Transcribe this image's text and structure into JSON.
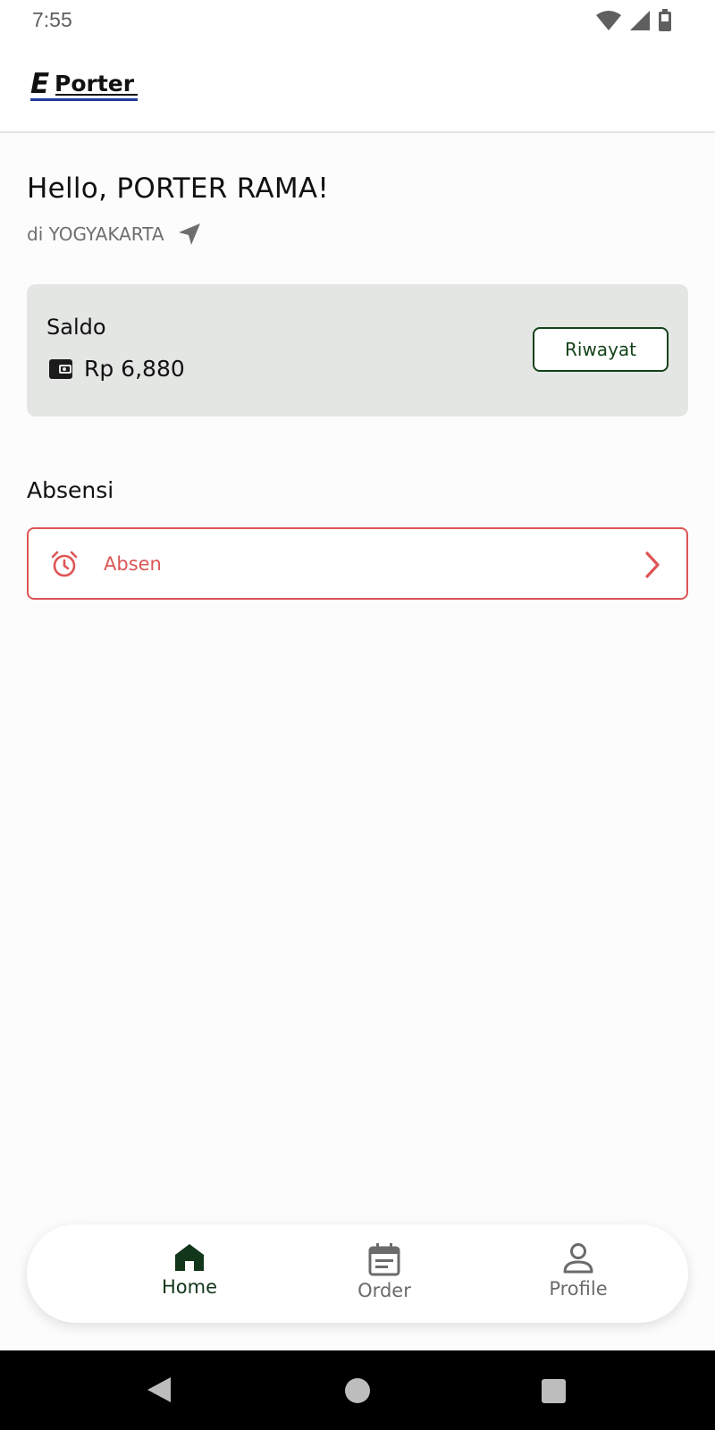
{
  "status_bar": {
    "time": "7:55",
    "icons": [
      "wifi-icon",
      "signal-icon",
      "battery-icon"
    ]
  },
  "app": {
    "logo_text_e": "E",
    "logo_text_rest": "Porter"
  },
  "greeting": {
    "text": "Hello, PORTER RAMA!",
    "location": "di YOGYAKARTA",
    "location_icon": "navigation-arrow-icon"
  },
  "saldo": {
    "label": "Saldo",
    "amount": "Rp 6,880",
    "wallet_icon": "wallet-icon",
    "history_button": "Riwayat"
  },
  "absensi": {
    "title": "Absensi",
    "item_label": "Absen",
    "item_icon": "alarm-clock-icon",
    "chevron_icon": "chevron-right-icon"
  },
  "bottom_nav": {
    "items": [
      {
        "label": "Home",
        "icon": "home-icon",
        "active": true
      },
      {
        "label": "Order",
        "icon": "calendar-icon",
        "active": false
      },
      {
        "label": "Profile",
        "icon": "person-icon",
        "active": false
      }
    ]
  },
  "colors": {
    "primary_green": "#12361a",
    "alert_red": "#dd5555",
    "card_gray": "#e4e6e4",
    "logo_blue": "#233a9b"
  }
}
